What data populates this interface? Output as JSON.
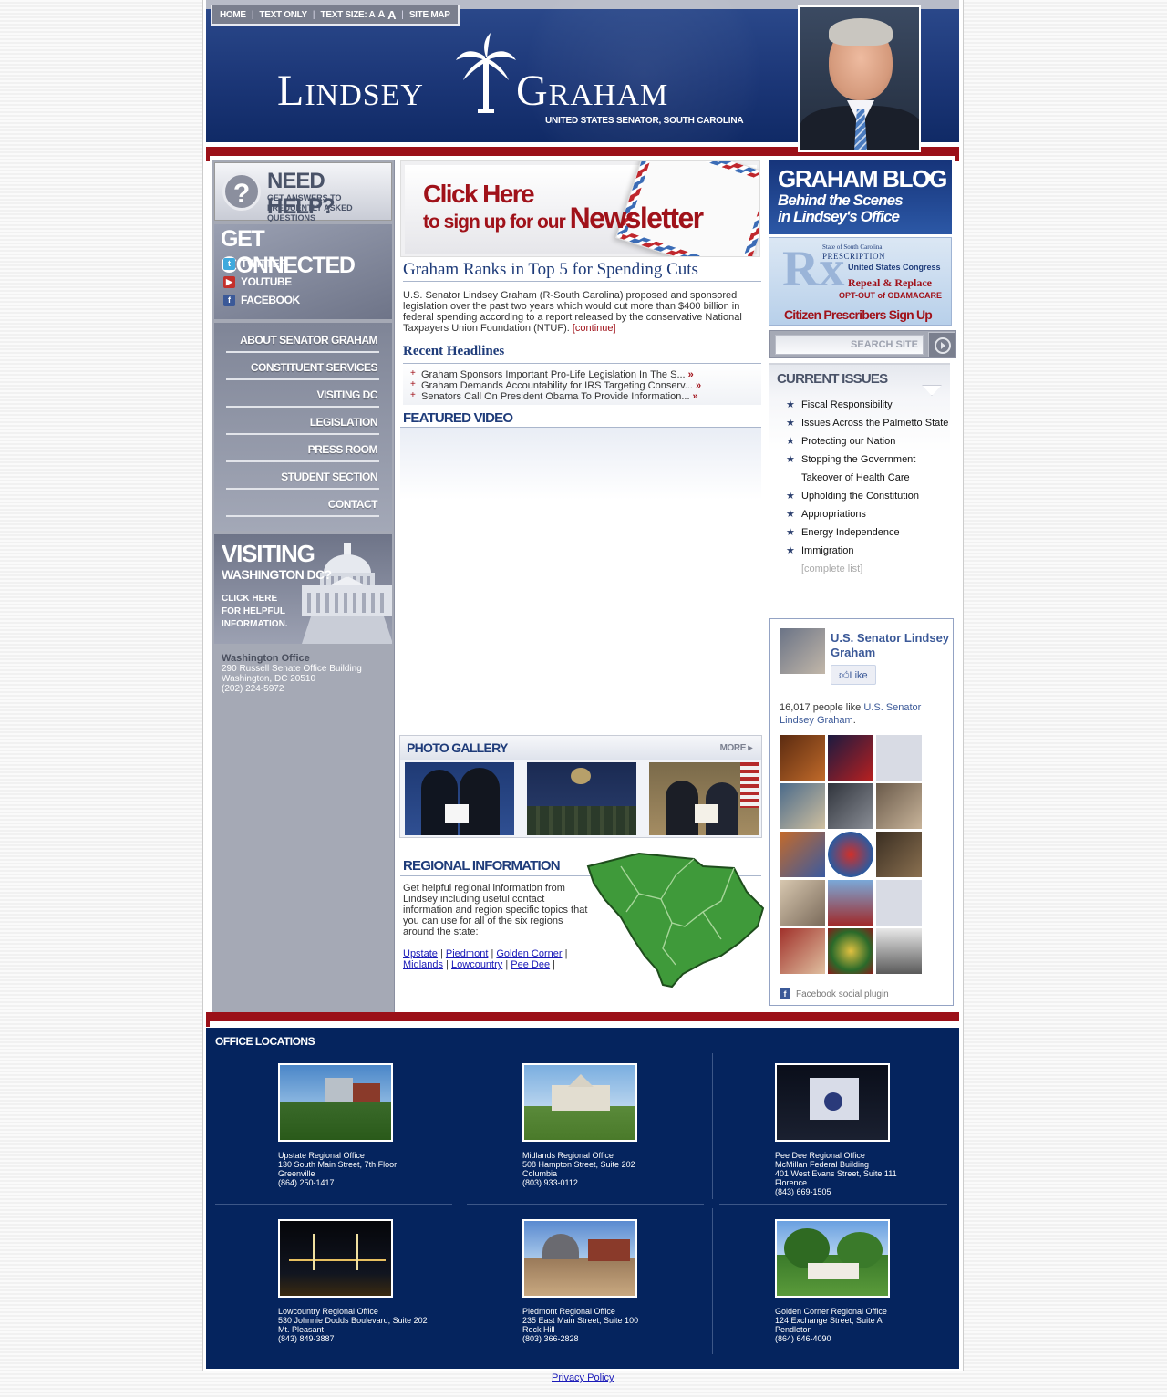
{
  "topnav": {
    "home": "HOME",
    "text_only": "TEXT ONLY",
    "text_size_label": "TEXT SIZE: A",
    "text_size_mid": "A",
    "text_size_big": "A",
    "site_map": "SITE MAP"
  },
  "header": {
    "first_name": "Lindsey",
    "last_name": "Graham",
    "tagline": "UNITED STATES SENATOR, SOUTH CAROLINA"
  },
  "left": {
    "need_help_title": "NEED HELP?",
    "need_help_sub": "GET ANSWERS TO FREQUENTLY ASKED QUESTIONS",
    "get_connected": "GET CONNECTED",
    "social": [
      "TWITTER",
      "YOUTUBE",
      "FACEBOOK"
    ],
    "nav": [
      "ABOUT SENATOR GRAHAM",
      "CONSTITUENT SERVICES",
      "VISITING DC",
      "LEGISLATION",
      "PRESS ROOM",
      "STUDENT SECTION",
      "CONTACT"
    ],
    "visiting_t1": "VISITING",
    "visiting_t2": "WASHINGTON DC?",
    "visiting_t3": "CLICK HERE FOR HELPFUL INFORMATION.",
    "wash_title": "Washington Office",
    "wash_lines": [
      "290 Russell Senate Office Building",
      "Washington, DC 20510",
      "(202) 224-5972"
    ]
  },
  "center": {
    "newsletter_t1": "Click Here",
    "newsletter_t2": "to sign up for our",
    "newsletter_t3": "Newsletter",
    "story_title": "Graham Ranks in Top 5 for Spending Cuts",
    "story_body": "U.S. Senator Lindsey Graham (R-South Carolina) proposed and sponsored legislation over the past two years which would cut more than $400 billion in federal spending according to a report released by the conservative National Taxpayers Union Foundation (NTUF).",
    "story_more": "[continue]",
    "recent_headlines": "Recent Headlines",
    "headlines": [
      "Graham Sponsors Important Pro-Life Legislation In The S...",
      "Graham Demands Accountability for IRS Targeting Conserv...",
      "Senators Call On President Obama To Provide Information..."
    ],
    "raquo": "»",
    "featured_video": "FEATURED VIDEO",
    "photo_gallery": "PHOTO GALLERY",
    "more": "MORE",
    "regional_title": "REGIONAL INFORMATION",
    "regional_body": "Get helpful regional information from Lindsey including useful contact information and region specific topics that you can use for all of the six regions around the state:",
    "regions": [
      "Upstate",
      "Piedmont",
      "Golden Corner",
      "Midlands",
      "Lowcountry",
      "Pee Dee"
    ]
  },
  "right": {
    "blog_title": "GRAHAM BLOG",
    "blog_sub1": "Behind the Scenes",
    "blog_sub2": "in Lindsey's Office",
    "rx_line1": "State of South Carolina",
    "rx_line2": "PRESCRIPTION",
    "rx_line3": "United States Congress",
    "rx_line4": "Repeal & Replace",
    "rx_line5": "OPT-OUT of OBAMACARE",
    "rx_cta": "Citizen Prescribers Sign Up Here!",
    "search_placeholder": "SEARCH SITE",
    "current_issues": "CURRENT ISSUES",
    "issues": [
      "Fiscal Responsibility",
      "Issues Across the Palmetto State",
      "Protecting our Nation",
      "Stopping the Government Takeover of Health Care",
      "Upholding the Constitution",
      "Appropriations",
      "Energy Independence",
      "Immigration"
    ],
    "complete_list": "[complete list]",
    "fb_name": "U.S. Senator Lindsey Graham",
    "fb_like": "Like",
    "fb_count": "16,017 people like",
    "fb_count_link": "U.S. Senator Lindsey Graham",
    "fb_plugin": "Facebook social plugin"
  },
  "offices": {
    "title": "OFFICE LOCATIONS",
    "list": [
      {
        "name": "Upstate Regional Office",
        "lines": [
          "130 South Main Street, 7th Floor",
          "Greenville",
          "(864) 250-1417"
        ]
      },
      {
        "name": "Midlands Regional Office",
        "lines": [
          "508 Hampton Street, Suite 202",
          "Columbia",
          "(803) 933-0112"
        ]
      },
      {
        "name": "Pee Dee Regional Office",
        "lines": [
          "McMillan Federal Building",
          "401 West Evans Street, Suite 111",
          "Florence",
          "(843) 669-1505"
        ]
      },
      {
        "name": "Lowcountry Regional Office",
        "lines": [
          "530 Johnnie Dodds Boulevard, Suite 202",
          "Mt. Pleasant",
          "(843) 849-3887"
        ]
      },
      {
        "name": "Piedmont Regional Office",
        "lines": [
          "235 East Main Street, Suite 100",
          "Rock Hill",
          "(803) 366-2828"
        ]
      },
      {
        "name": "Golden Corner Regional Office",
        "lines": [
          "124 Exchange Street, Suite A",
          "Pendleton",
          "(864) 646-4090"
        ]
      }
    ]
  },
  "footer": {
    "privacy": "Privacy Policy"
  }
}
